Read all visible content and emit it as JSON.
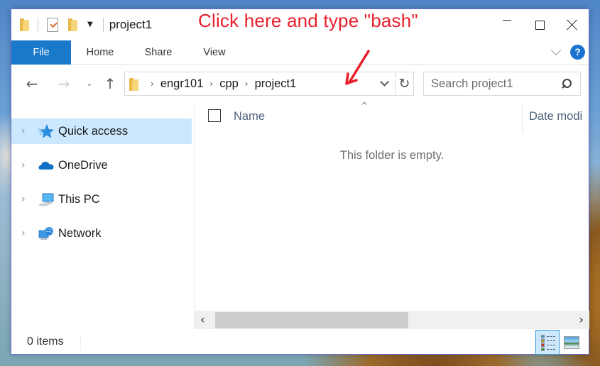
{
  "window": {
    "title": "project1",
    "controls": {
      "minimize": "minimize",
      "maximize": "maximize",
      "close": "close"
    }
  },
  "quick_access_toolbar": {
    "icons": [
      "folder-icon",
      "properties-icon",
      "new-folder-icon",
      "customize-dropdown-icon"
    ]
  },
  "annotation": {
    "text": "Click here and type \"bash\"",
    "color": "#e8202a"
  },
  "ribbon": {
    "tabs": [
      {
        "label": "File",
        "active": true
      },
      {
        "label": "Home"
      },
      {
        "label": "Share"
      },
      {
        "label": "View"
      }
    ],
    "help_label": "?"
  },
  "navigation": {
    "back": "←",
    "forward": "→",
    "recent": "˅",
    "up": "↑"
  },
  "address_bar": {
    "breadcrumbs": [
      "engr101",
      "cpp",
      "project1"
    ],
    "separator": "›",
    "refresh": "↻"
  },
  "search": {
    "placeholder": "Search project1",
    "value": ""
  },
  "nav_pane": {
    "items": [
      {
        "label": "Quick access",
        "icon": "quick-access-star-icon",
        "selected": true
      },
      {
        "label": "OneDrive",
        "icon": "onedrive-cloud-icon"
      },
      {
        "label": "This PC",
        "icon": "this-pc-icon"
      },
      {
        "label": "Network",
        "icon": "network-icon"
      }
    ],
    "expand_glyph": "›"
  },
  "content": {
    "columns": [
      "Name",
      "Date modi"
    ],
    "sort_indicator": "^",
    "empty_message": "This folder is empty."
  },
  "scrollbar": {
    "left": "‹",
    "right": "›"
  },
  "status_bar": {
    "item_count": "0 items",
    "views": [
      "details-view",
      "large-icons-view"
    ],
    "active_view": "details-view"
  },
  "colors": {
    "file_tab": "#1979ca",
    "selection": "#cce8ff",
    "help": "#1a73d0",
    "window_border": "#6b6fd8"
  }
}
